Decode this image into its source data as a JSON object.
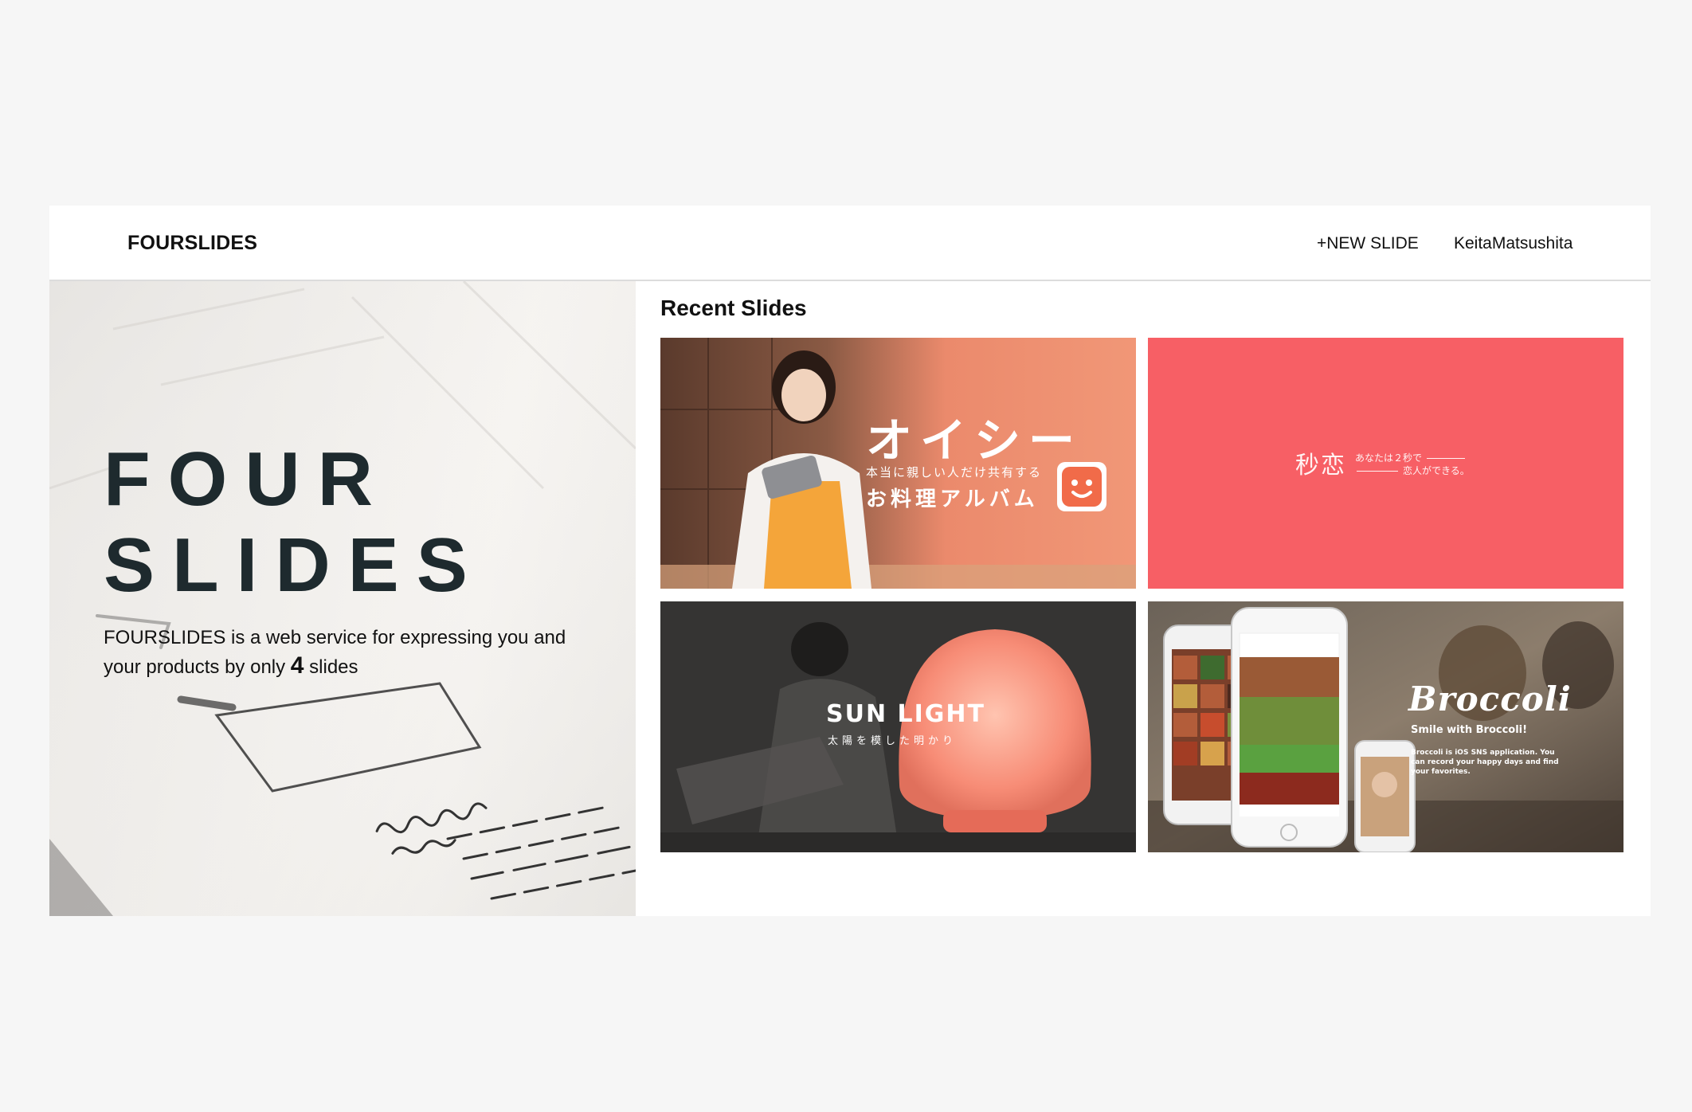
{
  "header": {
    "brand": "FOURSLIDES",
    "new_slide_label": "+NEW SLIDE",
    "user_name": "KeitaMatsushita"
  },
  "hero": {
    "title_line1": "FOUR",
    "title_line2": "SLIDES",
    "description_before": "FOURSLIDES is a web service for expressing you and your products by only ",
    "description_number": "4",
    "description_after": " slides"
  },
  "recent": {
    "heading": "Recent Slides",
    "slides": [
      {
        "title": "オイシー",
        "subtitle": "本当に親しい人だけ共有する",
        "subtitle2": "お料理アルバム",
        "accent": "#f27e52"
      },
      {
        "title": "秒恋",
        "tagline_1": "あなたは２秒で",
        "tagline_2": "恋人ができる。",
        "background": "#f75f65"
      },
      {
        "title": "SUN LIGHT",
        "subtitle": "太陽を模した明かり",
        "accent": "#f59a85"
      },
      {
        "title": "Broccoli",
        "subtitle": "Smile with Broccoli!",
        "description": "Broccoli is iOS SNS application. You can record your happy days and find your favorites."
      }
    ]
  },
  "colors": {
    "page_background": "#f6f6f6",
    "hero_text": "#1e2a2e",
    "coral": "#f75f65"
  }
}
